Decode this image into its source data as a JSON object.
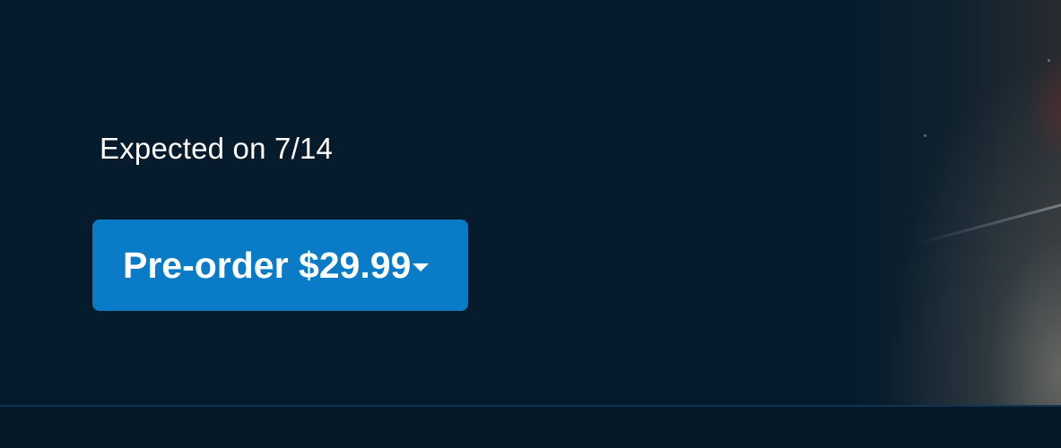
{
  "hero": {
    "heading": "",
    "release_text": "Expected on 7/14"
  },
  "purchase": {
    "button_label": "Pre-order $29.99",
    "dropdown_icon": "caret-down-icon",
    "accent_color": "#0a7cc7"
  },
  "theme": {
    "background": "#061c2d",
    "text_color": "#ffffff"
  }
}
